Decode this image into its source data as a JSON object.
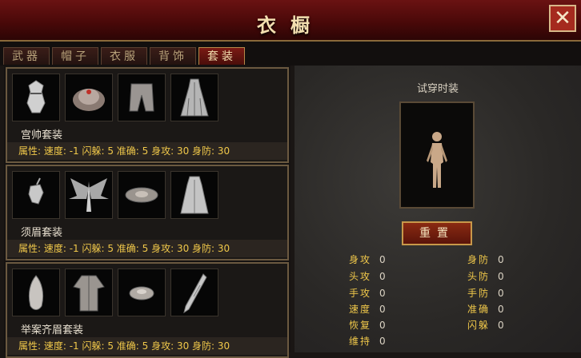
{
  "window": {
    "title": "衣橱",
    "close_label": "✕"
  },
  "tabs": [
    {
      "label": "武器",
      "active": false
    },
    {
      "label": "帽子",
      "active": false
    },
    {
      "label": "衣服",
      "active": false
    },
    {
      "label": "背饰",
      "active": false
    },
    {
      "label": "套装",
      "active": true
    }
  ],
  "sets": [
    {
      "name": "宫帅套装",
      "items": [
        "helmet-icon",
        "hat-icon",
        "pants-icon",
        "cape-icon"
      ],
      "attrs": "属性: 速度: -1 闪躲: 5 准确: 5 身攻: 30 身防: 30"
    },
    {
      "name": "须眉套装",
      "items": [
        "headgear-icon",
        "wings-icon",
        "hat-icon",
        "cape-icon"
      ],
      "attrs": "属性: 速度: -1 闪躲: 5 准确: 5 身攻: 30 身防: 30"
    },
    {
      "name": "举案齐眉套装",
      "items": [
        "headgear-icon",
        "robe-icon",
        "hat-icon",
        "cape-icon"
      ],
      "attrs": "属性: 速度: -1 闪躲: 5 准确: 5 身攻: 30 身防: 30"
    }
  ],
  "preview": {
    "label": "试穿时装",
    "reset_label": "重置",
    "stats_left": [
      {
        "label": "身攻",
        "value": "0"
      },
      {
        "label": "头攻",
        "value": "0"
      },
      {
        "label": "手攻",
        "value": "0"
      },
      {
        "label": "速度",
        "value": "0"
      },
      {
        "label": "恢复",
        "value": "0"
      },
      {
        "label": "维持",
        "value": "0"
      }
    ],
    "stats_right": [
      {
        "label": "身防",
        "value": "0"
      },
      {
        "label": "头防",
        "value": "0"
      },
      {
        "label": "手防",
        "value": "0"
      },
      {
        "label": "准确",
        "value": "0"
      },
      {
        "label": "闪躲",
        "value": "0"
      }
    ]
  }
}
